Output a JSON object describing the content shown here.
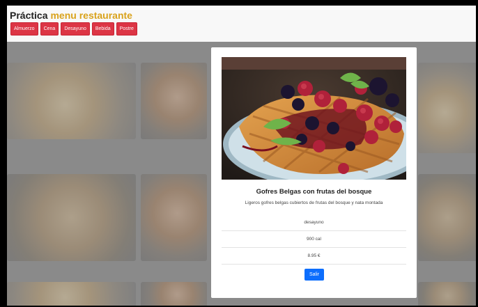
{
  "header": {
    "title_main": "Práctica",
    "title_accent": "menu restaurante",
    "nav": [
      "Almuerzo",
      "Cena",
      "Desayuno",
      "Bebida",
      "Postre"
    ]
  },
  "modal": {
    "name": "Gofres Belgas con frutas del bosque",
    "description": "Ligeros gofres belgas cubiertos de frutas del bosque y nata montada",
    "category": "desayuno",
    "calories": "900 cal",
    "price": "8.95 €",
    "exit_label": "Salir"
  },
  "colors": {
    "accent": "#d9a21b",
    "nav_button": "#dc3545",
    "primary": "#0d6efd"
  }
}
